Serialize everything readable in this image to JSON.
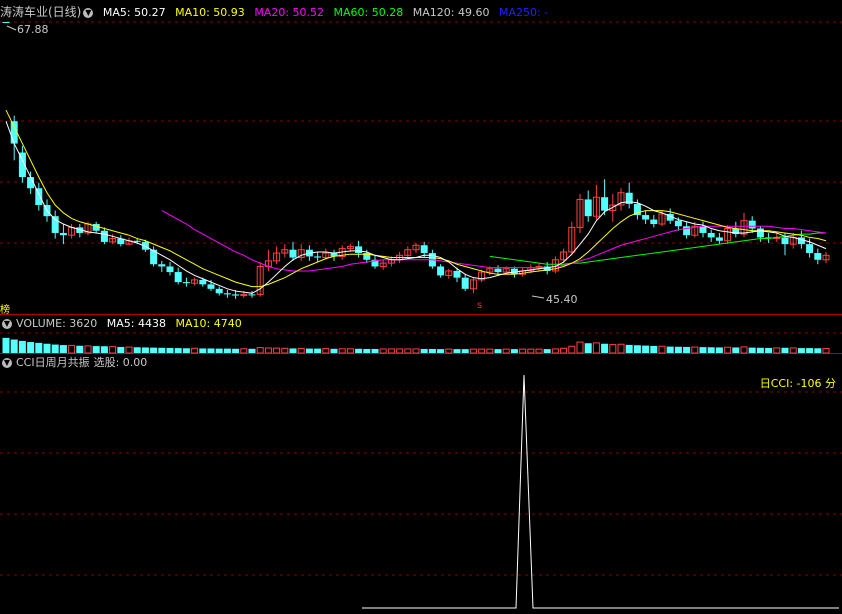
{
  "main": {
    "stock_name": "涛涛车业(日线)",
    "ma": [
      {
        "label": "MA5: 50.27",
        "color": "#ffffff"
      },
      {
        "label": "MA10: 50.93",
        "color": "#ffff00"
      },
      {
        "label": "MA20: 50.52",
        "color": "#ff00ff"
      },
      {
        "label": "MA60: 50.28",
        "color": "#00ff00"
      },
      {
        "label": "MA120: 49.60",
        "color": "#c8c8c8"
      },
      {
        "label": "MA250: -",
        "color": "#2020ff"
      }
    ],
    "high_label": "67.88",
    "low_label": "45.40",
    "left_mark": "榜",
    "s_mark": "s"
  },
  "volume": {
    "title": "VOLUME: 3620",
    "ma5": "MA5: 4438",
    "ma10": "MA10: 4740",
    "colors": {
      "title": "#c8c8c8",
      "ma5": "#ffffff",
      "ma10": "#ffff00"
    }
  },
  "indicator": {
    "title": "CCI日周月共振",
    "xuangu": "选股: 0.00",
    "cci_text": "日CCI: -106 分",
    "cci_color": "#ffff00"
  },
  "chart_data": {
    "type": "candlestick",
    "ohlc": [
      [
        67.88,
        67.88,
        67.88,
        67.88
      ],
      [
        59.0,
        57.0,
        59.5,
        55.5
      ],
      [
        56.2,
        54.0,
        56.8,
        53.5
      ],
      [
        54.0,
        53.0,
        54.5,
        52.5
      ],
      [
        53.0,
        51.5,
        53.5,
        51.0
      ],
      [
        51.5,
        50.5,
        52.0,
        50.0
      ],
      [
        50.5,
        49.0,
        51.0,
        48.5
      ],
      [
        49.0,
        48.8,
        49.8,
        48.0
      ],
      [
        48.8,
        49.5,
        49.8,
        48.5
      ],
      [
        49.5,
        49.0,
        49.8,
        48.6
      ],
      [
        49.0,
        49.8,
        50.0,
        48.8
      ],
      [
        49.8,
        49.2,
        50.0,
        49.0
      ],
      [
        49.2,
        48.2,
        49.5,
        48.0
      ],
      [
        48.2,
        48.5,
        48.9,
        48.0
      ],
      [
        48.5,
        48.0,
        48.8,
        47.8
      ],
      [
        48.0,
        48.3,
        48.6,
        47.9
      ],
      [
        48.3,
        48.2,
        48.5,
        48.0
      ],
      [
        48.2,
        47.5,
        48.4,
        47.3
      ],
      [
        47.5,
        46.2,
        47.8,
        46.0
      ],
      [
        46.2,
        46.0,
        46.5,
        45.5
      ],
      [
        46.0,
        45.5,
        46.4,
        45.2
      ],
      [
        45.5,
        44.6,
        45.9,
        44.4
      ],
      [
        44.6,
        44.5,
        45.0,
        44.2
      ],
      [
        44.5,
        44.8,
        45.0,
        44.3
      ],
      [
        44.8,
        44.4,
        45.0,
        44.2
      ],
      [
        44.4,
        44.0,
        44.8,
        43.8
      ],
      [
        44.0,
        43.6,
        44.2,
        43.4
      ],
      [
        43.6,
        43.5,
        43.9,
        43.2
      ],
      [
        43.5,
        43.4,
        43.9,
        43.1
      ],
      [
        43.4,
        43.5,
        43.8,
        43.2
      ],
      [
        43.5,
        43.5,
        43.8,
        43.2
      ],
      [
        43.5,
        46.0,
        46.4,
        43.3
      ],
      [
        46.0,
        46.5,
        47.5,
        45.6
      ],
      [
        46.5,
        47.2,
        47.8,
        46.2
      ],
      [
        47.2,
        47.5,
        48.0,
        46.8
      ],
      [
        47.5,
        46.8,
        48.2,
        46.5
      ],
      [
        46.8,
        47.5,
        48.0,
        46.5
      ],
      [
        47.5,
        46.9,
        47.9,
        46.5
      ],
      [
        46.9,
        46.8,
        47.3,
        46.4
      ],
      [
        46.8,
        47.2,
        47.6,
        46.6
      ],
      [
        47.2,
        46.9,
        47.5,
        46.5
      ],
      [
        46.9,
        47.6,
        47.9,
        46.6
      ],
      [
        47.6,
        47.8,
        48.0,
        47.3
      ],
      [
        47.8,
        47.2,
        48.3,
        46.8
      ],
      [
        47.2,
        46.6,
        47.5,
        46.3
      ],
      [
        46.6,
        46.0,
        47.0,
        45.8
      ],
      [
        46.0,
        46.3,
        46.6,
        45.7
      ],
      [
        46.3,
        46.6,
        46.9,
        46.0
      ],
      [
        46.6,
        47.0,
        47.3,
        46.3
      ],
      [
        47.0,
        47.5,
        47.8,
        46.7
      ],
      [
        47.5,
        47.9,
        48.1,
        47.2
      ],
      [
        47.9,
        47.2,
        48.2,
        46.8
      ],
      [
        47.2,
        46.0,
        47.5,
        45.8
      ],
      [
        46.0,
        45.2,
        46.2,
        45.0
      ],
      [
        45.2,
        45.6,
        45.8,
        44.9
      ],
      [
        45.6,
        45.0,
        45.9,
        44.6
      ],
      [
        45.0,
        44.0,
        45.3,
        43.8
      ],
      [
        44.0,
        44.8,
        45.0,
        43.6
      ],
      [
        44.8,
        45.5,
        45.7,
        44.6
      ],
      [
        45.5,
        45.8,
        46.0,
        45.2
      ],
      [
        45.8,
        45.5,
        46.1,
        45.2
      ],
      [
        45.5,
        45.8,
        46.0,
        45.3
      ],
      [
        45.8,
        45.3,
        46.0,
        45.0
      ],
      [
        45.3,
        45.6,
        45.9,
        45.1
      ],
      [
        45.6,
        45.9,
        46.2,
        45.4
      ],
      [
        45.9,
        46.0,
        46.3,
        45.6
      ],
      [
        46.0,
        45.6,
        46.4,
        45.3
      ],
      [
        45.6,
        46.6,
        46.9,
        45.4
      ],
      [
        46.6,
        47.3,
        47.6,
        46.3
      ],
      [
        47.3,
        49.5,
        50.0,
        47.0
      ],
      [
        49.5,
        52.0,
        52.5,
        49.0
      ],
      [
        52.0,
        50.5,
        52.8,
        50.0
      ],
      [
        50.5,
        52.2,
        53.3,
        50.2
      ],
      [
        52.2,
        51.0,
        53.8,
        50.6
      ],
      [
        51.0,
        51.5,
        52.5,
        50.0
      ],
      [
        51.5,
        52.6,
        53.0,
        51.0
      ],
      [
        52.6,
        51.6,
        53.5,
        51.2
      ],
      [
        51.6,
        50.6,
        52.0,
        50.2
      ],
      [
        50.6,
        50.2,
        51.0,
        49.8
      ],
      [
        50.2,
        49.8,
        50.6,
        49.5
      ],
      [
        49.8,
        50.7,
        51.0,
        49.6
      ],
      [
        50.7,
        50.1,
        51.2,
        49.8
      ],
      [
        50.1,
        49.6,
        50.4,
        49.2
      ],
      [
        49.6,
        48.8,
        50.0,
        48.5
      ],
      [
        48.8,
        49.6,
        50.0,
        48.6
      ],
      [
        49.6,
        49.0,
        50.0,
        48.6
      ],
      [
        49.0,
        48.6,
        49.3,
        48.2
      ],
      [
        48.6,
        48.3,
        49.0,
        48.0
      ],
      [
        48.3,
        49.4,
        49.7,
        48.0
      ],
      [
        49.4,
        48.9,
        50.0,
        48.6
      ],
      [
        48.9,
        50.1,
        50.8,
        48.6
      ],
      [
        50.1,
        49.4,
        50.5,
        49.0
      ],
      [
        49.4,
        48.6,
        49.6,
        48.2
      ],
      [
        48.6,
        48.5,
        49.0,
        48.1
      ],
      [
        48.5,
        48.6,
        49.0,
        48.2
      ],
      [
        48.6,
        48.0,
        49.0,
        47.0
      ],
      [
        48.0,
        48.6,
        49.0,
        47.6
      ],
      [
        48.6,
        48.0,
        49.2,
        47.6
      ],
      [
        48.0,
        47.2,
        48.5,
        46.8
      ],
      [
        47.2,
        46.6,
        47.6,
        46.2
      ],
      [
        46.6,
        47.0,
        47.3,
        46.3
      ]
    ],
    "ma5": [
      59,
      57,
      55.5,
      54,
      52.5,
      51,
      50.2,
      49.8,
      49.5,
      49.3,
      49.1,
      49.0,
      48.9,
      48.7,
      48.5,
      48.3,
      48.1,
      47.8,
      47.4,
      47.0,
      46.6,
      46.1,
      45.6,
      45.2,
      44.9,
      44.6,
      44.3,
      44.0,
      43.8,
      43.7,
      43.6,
      44.0,
      44.6,
      45.3,
      46.0,
      46.6,
      47.0,
      47.2,
      47.3,
      47.3,
      47.2,
      47.3,
      47.4,
      47.4,
      47.3,
      47.0,
      46.8,
      46.6,
      46.6,
      46.7,
      46.8,
      47.0,
      47.0,
      46.8,
      46.4,
      45.8,
      45.3,
      45.0,
      44.9,
      45.0,
      45.2,
      45.4,
      45.5,
      45.6,
      45.7,
      45.8,
      45.9,
      46.0,
      46.4,
      47.1,
      48.0,
      48.9,
      50.1,
      50.9,
      51.3,
      51.7,
      51.8,
      51.7,
      51.4,
      51.0,
      50.8,
      50.5,
      50.2,
      50.0,
      49.8,
      49.7,
      49.4,
      49.2,
      49.1,
      49.0,
      49.0,
      49.1,
      49.2,
      49.1,
      49.0,
      48.7,
      48.6,
      48.4,
      48.2,
      47.9,
      47.6
    ],
    "ma10": [
      60,
      58.5,
      57,
      55.5,
      54,
      52.6,
      51.5,
      50.8,
      50.3,
      50.0,
      49.8,
      49.6,
      49.4,
      49.2,
      49.0,
      48.8,
      48.5,
      48.3,
      48.0,
      47.7,
      47.4,
      47.0,
      46.6,
      46.2,
      45.8,
      45.5,
      45.2,
      44.9,
      44.6,
      44.4,
      44.2,
      44.2,
      44.4,
      44.7,
      45.0,
      45.4,
      45.8,
      46.1,
      46.4,
      46.7,
      46.9,
      47.0,
      47.1,
      47.1,
      47.1,
      47.0,
      46.9,
      46.8,
      46.8,
      46.8,
      46.8,
      46.8,
      46.8,
      46.7,
      46.5,
      46.2,
      46.0,
      45.8,
      45.6,
      45.4,
      45.3,
      45.3,
      45.3,
      45.4,
      45.5,
      45.6,
      45.7,
      45.8,
      46.0,
      46.3,
      46.7,
      47.3,
      48.0,
      48.7,
      49.4,
      50.0,
      50.5,
      50.8,
      51.0,
      51.0,
      51.0,
      50.9,
      50.7,
      50.5,
      50.3,
      50.1,
      49.9,
      49.7,
      49.5,
      49.4,
      49.3,
      49.2,
      49.2,
      49.2,
      49.1,
      49.0,
      48.9,
      48.8,
      48.6,
      48.5,
      48.3
    ],
    "ma20": [
      null,
      null,
      null,
      null,
      null,
      null,
      null,
      null,
      null,
      null,
      null,
      null,
      null,
      null,
      null,
      null,
      null,
      null,
      null,
      51.0,
      50.6,
      50.2,
      49.8,
      49.3,
      48.9,
      48.5,
      48.1,
      47.7,
      47.3,
      47.0,
      46.6,
      46.3,
      46.0,
      45.8,
      45.7,
      45.6,
      45.6,
      45.6,
      45.7,
      45.8,
      45.9,
      46.0,
      46.2,
      46.3,
      46.4,
      46.5,
      46.6,
      46.6,
      46.6,
      46.6,
      46.6,
      46.6,
      46.6,
      46.5,
      46.4,
      46.3,
      46.2,
      46.1,
      46.0,
      45.9,
      45.9,
      45.9,
      45.9,
      45.9,
      45.9,
      45.9,
      45.9,
      46.0,
      46.1,
      46.3,
      46.5,
      46.7,
      47.0,
      47.3,
      47.6,
      47.9,
      48.1,
      48.3,
      48.5,
      48.7,
      48.9,
      49.1,
      49.3,
      49.4,
      49.5,
      49.6,
      49.6,
      49.6,
      49.6,
      49.6,
      49.6,
      49.6,
      49.6,
      49.6,
      49.5,
      49.4,
      49.4,
      49.3,
      49.2,
      49.1,
      49.0
    ],
    "ma60": [
      null,
      null,
      null,
      null,
      null,
      null,
      null,
      null,
      null,
      null,
      null,
      null,
      null,
      null,
      null,
      null,
      null,
      null,
      null,
      null,
      null,
      null,
      null,
      null,
      null,
      null,
      null,
      null,
      null,
      null,
      null,
      null,
      null,
      null,
      null,
      null,
      null,
      null,
      null,
      null,
      null,
      null,
      null,
      null,
      null,
      null,
      null,
      null,
      null,
      null,
      null,
      null,
      null,
      null,
      null,
      null,
      null,
      null,
      null,
      46.9,
      46.8,
      46.7,
      46.6,
      46.5,
      46.4,
      46.3,
      46.2,
      46.2,
      46.2,
      46.3,
      46.3,
      46.4,
      46.5,
      46.6,
      46.7,
      46.8,
      46.9,
      47.0,
      47.1,
      47.2,
      47.3,
      47.4,
      47.5,
      47.6,
      47.7,
      47.8,
      47.9,
      48.0,
      48.1,
      48.2,
      48.3,
      48.4,
      48.5,
      48.5,
      48.6,
      48.7,
      48.8,
      48.9,
      48.9,
      49.0,
      49.0
    ],
    "volume": [
      9000,
      8000,
      7200,
      6500,
      6000,
      5500,
      5000,
      4700,
      4500,
      4300,
      4200,
      4100,
      4000,
      3800,
      3600,
      3500,
      3400,
      3300,
      3200,
      3100,
      3000,
      2900,
      2800,
      2800,
      2700,
      2700,
      2600,
      2600,
      2500,
      2500,
      2500,
      3200,
      3000,
      2900,
      2800,
      2700,
      2700,
      2600,
      2600,
      2600,
      2500,
      2500,
      2500,
      2500,
      2400,
      2400,
      2400,
      2400,
      2400,
      2400,
      2400,
      2400,
      2400,
      2300,
      2300,
      2300,
      2300,
      2300,
      2300,
      2300,
      2300,
      2300,
      2300,
      2300,
      2300,
      2300,
      2300,
      2400,
      2800,
      4000,
      6500,
      5800,
      6000,
      5500,
      5000,
      5200,
      4800,
      4600,
      4400,
      4200,
      4000,
      3800,
      3700,
      3600,
      3500,
      3500,
      3400,
      3300,
      3400,
      3300,
      3600,
      3200,
      3100,
      3000,
      3000,
      3100,
      3000,
      2900,
      2900,
      2800,
      2700
    ],
    "cci_spike_bar": 67,
    "price_range": [
      44.0,
      70.0
    ]
  }
}
